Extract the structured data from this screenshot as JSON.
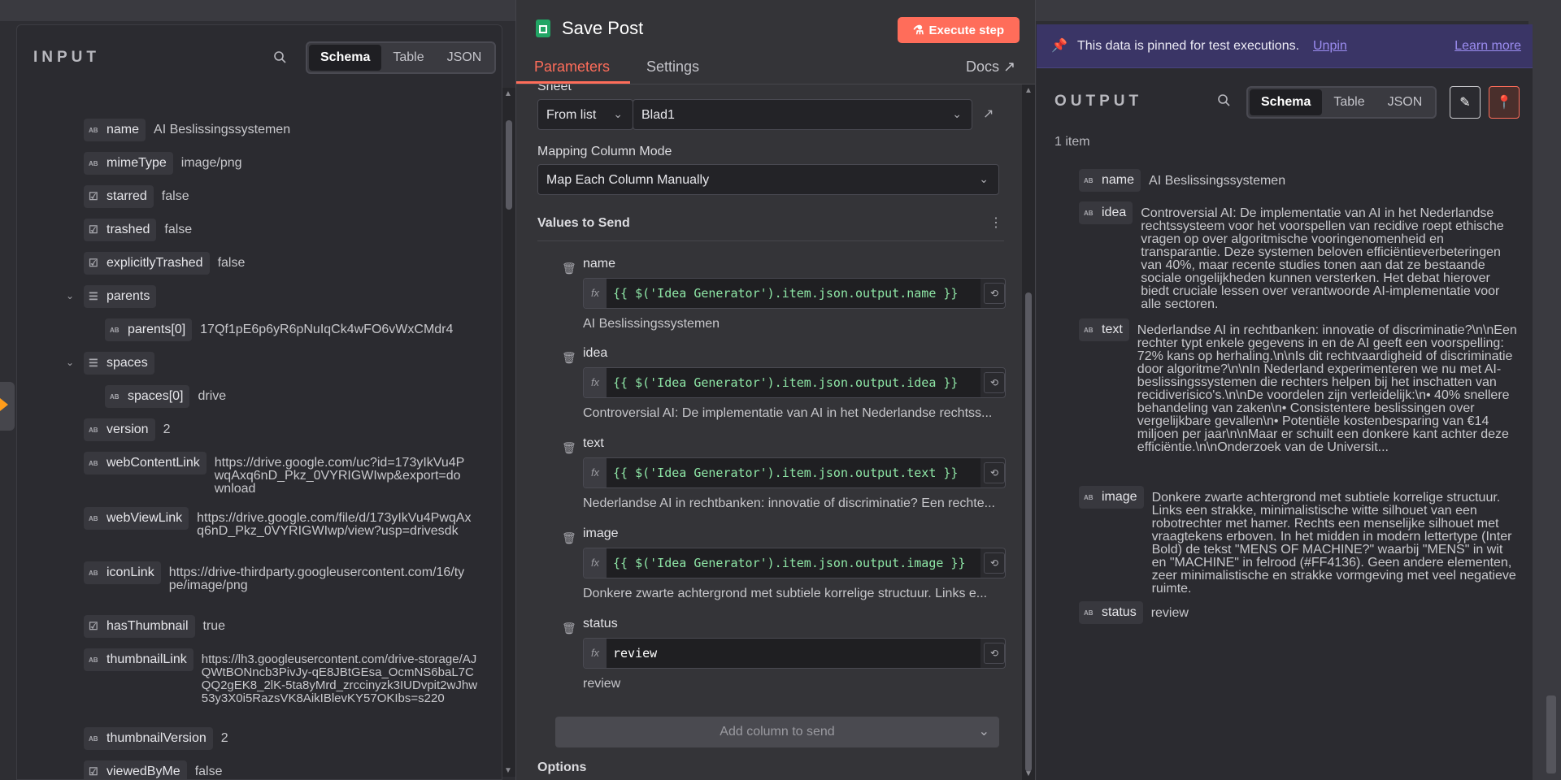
{
  "input": {
    "title": "INPUT",
    "view_tabs": [
      "Schema",
      "Table",
      "JSON"
    ],
    "active_view": "Schema",
    "fields": [
      {
        "key": "name",
        "type": "string",
        "value": "AI Beslissingssystemen"
      },
      {
        "key": "mimeType",
        "type": "string",
        "value": "image/png"
      },
      {
        "key": "starred",
        "type": "boolean",
        "value": "false"
      },
      {
        "key": "trashed",
        "type": "boolean",
        "value": "false"
      },
      {
        "key": "explicitlyTrashed",
        "type": "boolean",
        "value": "false"
      },
      {
        "key": "parents",
        "type": "array",
        "value": ""
      },
      {
        "key": "parents[0]",
        "type": "string",
        "value": "17Qf1pE6p6yR6pNuIqCk4wFO6vWxCMdr4"
      },
      {
        "key": "spaces",
        "type": "array",
        "value": ""
      },
      {
        "key": "spaces[0]",
        "type": "string",
        "value": "drive"
      },
      {
        "key": "version",
        "type": "string",
        "value": "2"
      },
      {
        "key": "webContentLink",
        "type": "string",
        "value": "https://drive.google.com/uc?id=173yIkVu4PwqAxq6nD_Pkz_0VYRIGWIwp&export=download"
      },
      {
        "key": "webViewLink",
        "type": "string",
        "value": "https://drive.google.com/file/d/173yIkVu4PwqAxq6nD_Pkz_0VYRIGWIwp/view?usp=drivesdk"
      },
      {
        "key": "iconLink",
        "type": "string",
        "value": "https://drive-thirdparty.googleusercontent.com/16/type/image/png"
      },
      {
        "key": "hasThumbnail",
        "type": "boolean",
        "value": "true"
      },
      {
        "key": "thumbnailLink",
        "type": "string",
        "value": "https://lh3.googleusercontent.com/drive-storage/AJQWtBONncb3PivJy-qE8JBtGEsa_OcmNS6baL7CQQ2gEK8_2lK-5ta8yMrd_zrccinyzk3IUDvpit2wJhw53y3X0i5RazsVK8AikIBlevKY57OKIbs=s220"
      },
      {
        "key": "thumbnailVersion",
        "type": "string",
        "value": "2"
      },
      {
        "key": "viewedByMe",
        "type": "boolean",
        "value": "false"
      }
    ]
  },
  "node": {
    "title": "Save Post",
    "execute_label": "Execute step",
    "tabs": [
      "Parameters",
      "Settings"
    ],
    "active_tab": "Parameters",
    "docs_label": "Docs",
    "sheet_label": "Sheet",
    "sheet_mode": "From list",
    "sheet_value": "Blad1",
    "mapping_label": "Mapping Column Mode",
    "mapping_value": "Map Each Column Manually",
    "values_label": "Values to Send",
    "columns": [
      {
        "name": "name",
        "expression": "{{ $('Idea Generator').item.json.output.name }}",
        "preview": "AI Beslissingssystemen",
        "is_expression": true
      },
      {
        "name": "idea",
        "expression": "{{ $('Idea Generator').item.json.output.idea }}",
        "preview": "Controversial AI: De implementatie van AI in het Nederlandse rechtss...",
        "is_expression": true
      },
      {
        "name": "text",
        "expression": "{{ $('Idea Generator').item.json.output.text }}",
        "preview": "Nederlandse AI in rechtbanken: innovatie of discriminatie? Een rechte...",
        "is_expression": true
      },
      {
        "name": "image",
        "expression": "{{ $('Idea Generator').item.json.output.image }}",
        "preview": "Donkere zwarte achtergrond met subtiele korrelige structuur. Links e...",
        "is_expression": true
      },
      {
        "name": "status",
        "expression": "review",
        "preview": "review",
        "is_expression": false
      }
    ],
    "add_column_label": "Add column to send",
    "options_label": "Options"
  },
  "output": {
    "pin_message": "This data is pinned for test executions.",
    "unpin_label": "Unpin",
    "learn_more_label": "Learn more",
    "title": "OUTPUT",
    "view_tabs": [
      "Schema",
      "Table",
      "JSON"
    ],
    "active_view": "Schema",
    "item_count": "1 item",
    "fields": [
      {
        "key": "name",
        "value": "AI Beslissingssystemen"
      },
      {
        "key": "idea",
        "value": "Controversial AI: De implementatie van AI in het Nederlandse rechtssysteem voor het voorspellen van recidive roept ethische vragen op over algoritmische vooringenomenheid en transparantie. Deze systemen beloven efficiëntieverbeteringen van 40%, maar recente studies tonen aan dat ze bestaande sociale ongelijkheden kunnen versterken. Het debat hierover biedt cruciale lessen over verantwoorde AI-implementatie voor alle sectoren."
      },
      {
        "key": "text",
        "value": "Nederlandse AI in rechtbanken: innovatie of discriminatie?\\n\\nEen rechter typt enkele gegevens in en de AI geeft een voorspelling: 72% kans op herhaling.\\n\\nIs dit rechtvaardigheid of discriminatie door algoritme?\\n\\nIn Nederland experimenteren we nu met AI-beslissingssystemen die rechters helpen bij het inschatten van recidiverisico's.\\n\\nDe voordelen zijn verleidelijk:\\n• 40% snellere behandeling van zaken\\n• Consistentere beslissingen over vergelijkbare gevallen\\n• Potentiële kostenbesparing van €14 miljoen per jaar\\n\\nMaar er schuilt een donkere kant achter deze efficiëntie.\\n\\nOnderzoek van de Universit..."
      },
      {
        "key": "image",
        "value": "Donkere zwarte achtergrond met subtiele korrelige structuur. Links een strakke, minimalistische witte silhouet van een robotrechter met hamer. Rechts een menselijke silhouet met vraagtekens erboven. In het midden in modern lettertype (Inter Bold) de tekst \"MENS OF MACHINE?\" waarbij \"MENS\" in wit en \"MACHINE\" in felrood (#FF4136). Geen andere elementen, zeer minimalistische en strakke vormgeving met veel negatieve ruimte."
      },
      {
        "key": "status",
        "value": "review"
      }
    ]
  }
}
